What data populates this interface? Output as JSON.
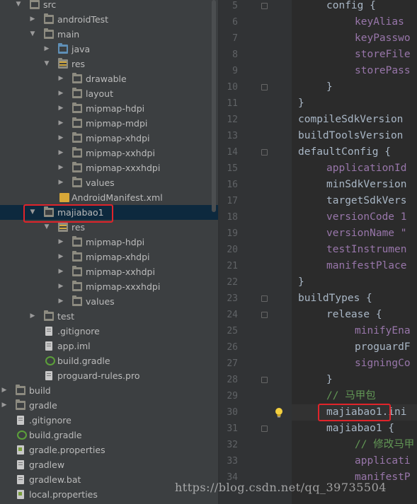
{
  "project_tree": {
    "items": [
      {
        "label": "src",
        "icon": "folder-icon",
        "expanded": true
      },
      {
        "label": "androidTest",
        "icon": "folder-icon",
        "expanded": false
      },
      {
        "label": "main",
        "icon": "folder-icon",
        "expanded": true
      },
      {
        "label": "java",
        "icon": "source-folder-icon",
        "expanded": false
      },
      {
        "label": "res",
        "icon": "resources-folder-icon",
        "expanded": true
      },
      {
        "label": "drawable",
        "icon": "folder-icon",
        "expanded": false
      },
      {
        "label": "layout",
        "icon": "folder-icon",
        "expanded": false
      },
      {
        "label": "mipmap-hdpi",
        "icon": "folder-icon",
        "expanded": false
      },
      {
        "label": "mipmap-mdpi",
        "icon": "folder-icon",
        "expanded": false
      },
      {
        "label": "mipmap-xhdpi",
        "icon": "folder-icon",
        "expanded": false
      },
      {
        "label": "mipmap-xxhdpi",
        "icon": "folder-icon",
        "expanded": false
      },
      {
        "label": "mipmap-xxxhdpi",
        "icon": "folder-icon",
        "expanded": false
      },
      {
        "label": "values",
        "icon": "folder-icon",
        "expanded": false
      },
      {
        "label": "AndroidManifest.xml",
        "icon": "manifest-file-icon"
      },
      {
        "label": "majiabao1",
        "icon": "folder-icon",
        "expanded": true,
        "selected": true
      },
      {
        "label": "res",
        "icon": "resources-folder-icon",
        "expanded": true
      },
      {
        "label": "mipmap-hdpi",
        "icon": "folder-icon",
        "expanded": false
      },
      {
        "label": "mipmap-xhdpi",
        "icon": "folder-icon",
        "expanded": false
      },
      {
        "label": "mipmap-xxhdpi",
        "icon": "folder-icon",
        "expanded": false
      },
      {
        "label": "mipmap-xxxhdpi",
        "icon": "folder-icon",
        "expanded": false
      },
      {
        "label": "values",
        "icon": "folder-icon",
        "expanded": false
      },
      {
        "label": "test",
        "icon": "folder-icon",
        "expanded": false
      },
      {
        "label": ".gitignore",
        "icon": "text-file-icon"
      },
      {
        "label": "app.iml",
        "icon": "module-file-icon"
      },
      {
        "label": "build.gradle",
        "icon": "gradle-file-icon"
      },
      {
        "label": "proguard-rules.pro",
        "icon": "text-file-icon"
      },
      {
        "label": "build",
        "icon": "folder-icon",
        "expanded": false
      },
      {
        "label": "gradle",
        "icon": "folder-icon",
        "expanded": false
      },
      {
        "label": ".gitignore",
        "icon": "text-file-icon"
      },
      {
        "label": "build.gradle",
        "icon": "gradle-file-icon"
      },
      {
        "label": "gradle.properties",
        "icon": "properties-file-icon"
      },
      {
        "label": "gradlew",
        "icon": "text-file-icon"
      },
      {
        "label": "gradlew.bat",
        "icon": "text-file-icon"
      },
      {
        "label": "local.properties",
        "icon": "properties-file-icon"
      }
    ]
  },
  "editor": {
    "line_numbers": [
      "5",
      "6",
      "7",
      "8",
      "9",
      "10",
      "11",
      "12",
      "13",
      "14",
      "15",
      "16",
      "17",
      "18",
      "19",
      "20",
      "21",
      "22",
      "23",
      "24",
      "25",
      "26",
      "27",
      "28",
      "29",
      "30",
      "31",
      "32",
      "33",
      "34"
    ],
    "lines": [
      "config {",
      "keyAlias",
      "keyPasswo",
      "storeFile",
      "storePass",
      "}",
      "}",
      "compileSdkVersion",
      "buildToolsVersion",
      "defaultConfig {",
      "applicationId",
      "minSdkVersion",
      "targetSdkVers",
      "versionCode 1",
      "versionName \"",
      "testInstrumen",
      "manifestPlace",
      "}",
      "buildTypes {",
      "release {",
      "minifyEna",
      "proguardF",
      "signingCo",
      "}",
      "// 马甲包",
      "majiabao1.ini",
      "majiabao1 {",
      "// 修改马甲",
      "applicati",
      "manifestP"
    ],
    "intention_icon": "lightbulb-icon"
  },
  "watermark": "https://blog.csdn.net/qq_39735504",
  "colors": {
    "highlight_box": "#e0242a",
    "selection": "#0d293e",
    "editor_bg": "#2b2b2b",
    "tree_bg": "#3c3f41"
  }
}
